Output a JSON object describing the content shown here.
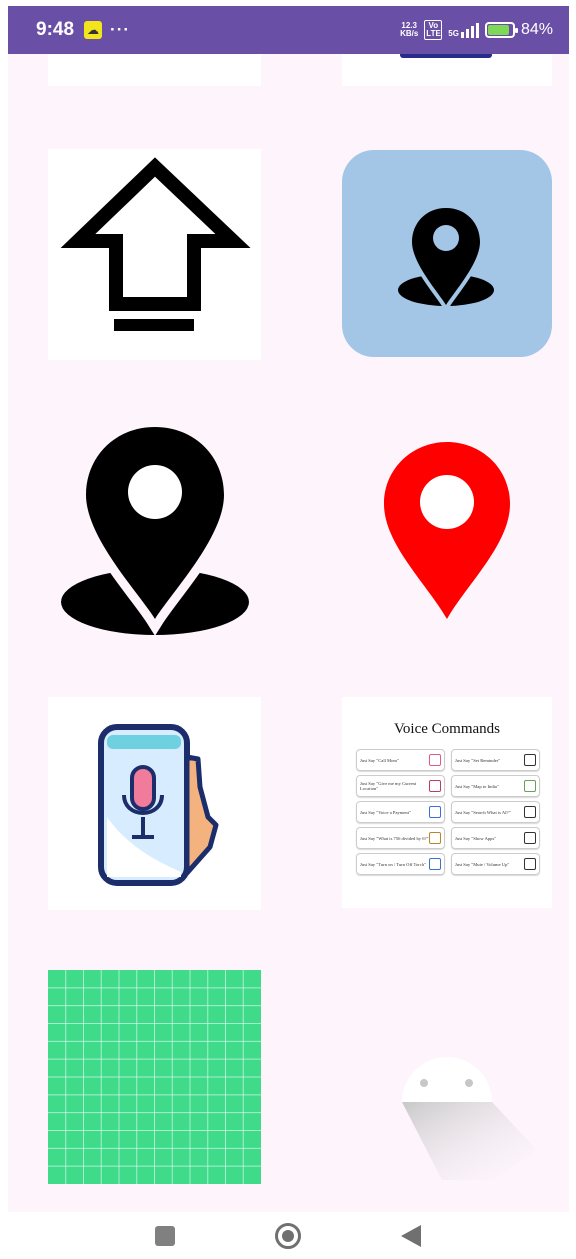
{
  "status_bar": {
    "time": "9:48",
    "dots": "···",
    "network_speed": "12.3",
    "network_unit": "KB/s",
    "volte": "Vo LTE",
    "signal": "5G",
    "battery": "84%"
  },
  "gallery": {
    "tiles": [
      {
        "name": "upload-arrow-image"
      },
      {
        "name": "location-pin-blue-image"
      },
      {
        "name": "location-pin-black-image"
      },
      {
        "name": "location-pin-red-image"
      },
      {
        "name": "voice-assistant-phone-image"
      },
      {
        "name": "voice-commands-image"
      },
      {
        "name": "green-grid-image"
      },
      {
        "name": "android-logo-image"
      }
    ]
  },
  "voice_commands": {
    "title": "Voice Commands",
    "cards": [
      {
        "text": "Just Say  \"Call Mom\"",
        "icon": "phone-icon",
        "color": "#e05a8a"
      },
      {
        "text": "Just Say \"Set Reminder\"",
        "icon": "bell-icon",
        "color": "#333333"
      },
      {
        "text": "Just Say \"Give me my Current Location\"",
        "icon": "map-pin-icon",
        "color": "#c0396b"
      },
      {
        "text": "Just Say \"Map to India\"",
        "icon": "map-icon",
        "color": "#6a9e5a"
      },
      {
        "text": "Just Say \"Voice a Payment\"",
        "icon": "payment-icon",
        "color": "#3a6fd8"
      },
      {
        "text": "Just Say \"Search What is AI?\"",
        "icon": "search-icon",
        "color": "#333333"
      },
      {
        "text": "Just Say \"What is 756 divided by 6?\"",
        "icon": "calculator-icon",
        "color": "#b8862a"
      },
      {
        "text": "Just Say \"Show Apps\"",
        "icon": "apps-icon",
        "color": "#333333"
      },
      {
        "text": "Just Say \"Turn on / Turn Off Torch\"",
        "icon": "torch-icon",
        "color": "#3a6fd8"
      },
      {
        "text": "Just Say \"Mute / Volume Up\"",
        "icon": "compass-icon",
        "color": "#333333"
      }
    ]
  },
  "colors": {
    "status_bar": "#6a4fa6",
    "background": "#fdf4fc",
    "pin_blue_bg": "#a3c5e6",
    "pin_red": "#ff0000",
    "grid_green": "#3fdb8b"
  }
}
